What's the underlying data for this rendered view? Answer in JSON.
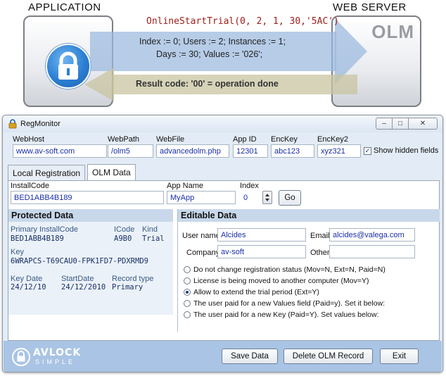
{
  "diagram": {
    "app_label": "APPLICATION",
    "server_label": "WEB SERVER",
    "server_badge": "OLM",
    "call": "OnlineStartTrial(0, 2, 1, 30,'5AC')",
    "params_line1": "Index := 0; Users := 2; Instances := 1;",
    "params_line2": "Days := 30;  Values := '026';",
    "result": "Result code:   '00' = operation done",
    "colors": {
      "request_arrow": "#9ab9de",
      "response_arrow": "#c8c4a0",
      "call_text": "#a0201c"
    }
  },
  "window": {
    "title": "RegMonitor",
    "controls": {
      "minimize": "minimize-icon",
      "maximize": "maximize-icon",
      "close": "close-icon"
    }
  },
  "top_fields": {
    "webhost": {
      "label": "WebHost",
      "value": "www.av-soft.com"
    },
    "webpath": {
      "label": "WebPath",
      "value": "/olm5"
    },
    "webfile": {
      "label": "WebFile",
      "value": "advancedolm.php"
    },
    "appid": {
      "label": "App ID",
      "value": "12301"
    },
    "enckey": {
      "label": "EncKey",
      "value": "abc123"
    },
    "enckey2": {
      "label": "EncKey2",
      "value": "xyz321"
    },
    "show_hidden": {
      "label": "Show hidden fields",
      "checked": true
    }
  },
  "tabs": [
    {
      "label": "Local Registration",
      "active": false
    },
    {
      "label": "OLM Data",
      "active": true
    }
  ],
  "olm": {
    "installcode_label": "InstallCode",
    "installcode_value": "BED1ABB4B189",
    "appname_label": "App Name",
    "appname_value": "MyApp",
    "index_label": "Index",
    "index_value": "0",
    "go_label": "Go"
  },
  "protected": {
    "heading": "Protected Data",
    "primary_installcode_label": "Primary InstallCode",
    "primary_installcode_value": "BED1ABB4B189",
    "icode_label": "ICode",
    "icode_value": "A9B0",
    "kind_label": "Kind",
    "kind_value": "Trial",
    "key_label": "Key",
    "key_value": "6WRAPCS-T69CAU0-FPK1FD7-PDXRMD9",
    "keydate_label": "Key Date",
    "keydate_value": "24/12/10",
    "startdate_label": "StartDate",
    "startdate_value": "24/12/2010",
    "recordtype_label": "Record type",
    "recordtype_value": "Primary"
  },
  "editable": {
    "heading": "Editable Data",
    "username_label": "User name",
    "username_value": "Alcides",
    "email_label": "Email",
    "email_value": "alcides@valega.com",
    "company_label": "Company",
    "company_value": "av-soft",
    "other_label": "Other",
    "other_value": "",
    "options": [
      {
        "label": "Do not change registration status (Mov=N, Ext=N, Paid=N)",
        "selected": false
      },
      {
        "label": "License is being moved to another computer (Mov=Y)",
        "selected": false
      },
      {
        "label": "Allow to extend the trial period (Ext=Y)",
        "selected": true
      },
      {
        "label": "The user paid for a new Values field (Paid=y). Set it below:",
        "selected": false
      },
      {
        "label": "The user paid for a new Key (Paid=Y). Set values below:",
        "selected": false
      }
    ]
  },
  "footer": {
    "logo_top": "AVLOCK",
    "logo_bottom": "SIMPLE",
    "save_label": "Save Data",
    "delete_label": "Delete OLM Record",
    "exit_label": "Exit"
  }
}
